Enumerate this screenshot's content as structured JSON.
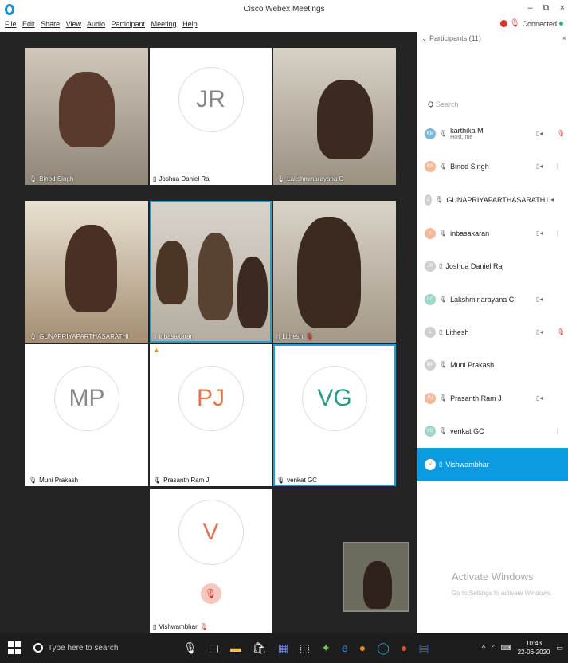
{
  "window": {
    "title": "Cisco Webex Meetings",
    "minimize": "–",
    "restore": "⧉",
    "close": "×"
  },
  "menu": [
    "File",
    "Edit",
    "Share",
    "View",
    "Audio",
    "Participant",
    "Meeting",
    "Help"
  ],
  "status": {
    "connected": "Connected"
  },
  "tiles": [
    {
      "name": "Binod Singh",
      "initials": ""
    },
    {
      "name": "Joshua Daniel Raj",
      "initials": "JR"
    },
    {
      "name": "Lakshminarayana C",
      "initials": ""
    },
    {
      "name": "GUNAPRIYAPARTHASARATHI",
      "initials": ""
    },
    {
      "name": "inbasakaran",
      "initials": ""
    },
    {
      "name": "Lithesh",
      "initials": ""
    },
    {
      "name": "Muni Prakash",
      "initials": "MP"
    },
    {
      "name": "Prasanth Ram J",
      "initials": "PJ"
    },
    {
      "name": "venkat GC",
      "initials": "VG"
    },
    {
      "name": "Vishwambhar",
      "initials": "V"
    }
  ],
  "panel": {
    "header": "Participants (11)",
    "search_placeholder": "Search",
    "participants": [
      {
        "initials": "KM",
        "name": "karthika M",
        "sub": "Host, me",
        "color": "#7fb8d9"
      },
      {
        "initials": "BS",
        "name": "Binod Singh",
        "sub": "",
        "color": "#f2b99a"
      },
      {
        "initials": "G",
        "name": "GUNAPRIYAPARTHASARATHI",
        "sub": "",
        "color": "#cfcfcf"
      },
      {
        "initials": "I",
        "name": "inbasakaran",
        "sub": "",
        "color": "#f2b99a"
      },
      {
        "initials": "JR",
        "name": "Joshua Daniel Raj",
        "sub": "",
        "color": "#cfcfcf"
      },
      {
        "initials": "LC",
        "name": "Lakshminarayana C",
        "sub": "",
        "color": "#9fd6c9"
      },
      {
        "initials": "L",
        "name": "Lithesh",
        "sub": "",
        "color": "#cfcfcf"
      },
      {
        "initials": "MP",
        "name": "Muni Prakash",
        "sub": "",
        "color": "#cfcfcf"
      },
      {
        "initials": "PJ",
        "name": "Prasanth Ram J",
        "sub": "",
        "color": "#f2b99a"
      },
      {
        "initials": "VG",
        "name": "venkat GC",
        "sub": "",
        "color": "#9fd6c9"
      },
      {
        "initials": "V",
        "name": "Vishwambhar",
        "sub": "",
        "color": "#f2b99a"
      }
    ]
  },
  "watermark": {
    "title": "Activate Windows",
    "subtitle": "Go to Settings to activate Windows."
  },
  "taskbar": {
    "search": "Type here to search",
    "time": "10:43",
    "date": "22-06-2020"
  }
}
